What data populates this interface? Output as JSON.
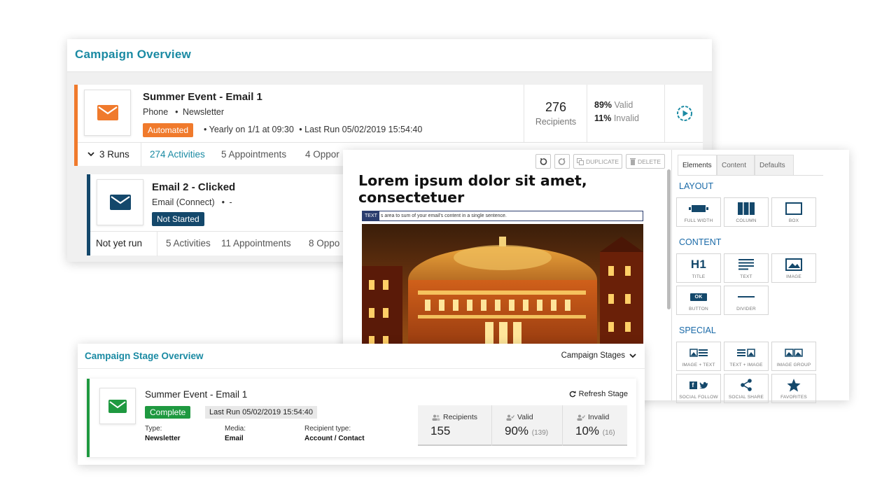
{
  "overview": {
    "title": "Campaign Overview",
    "card1": {
      "title": "Summer Event - Email 1",
      "media": "Phone",
      "type": "Newsletter",
      "badge": "Automated",
      "schedule": "Yearly on 1/1 at 09:30",
      "last_run": "Last Run 05/02/2019 15:54:40",
      "recipients_value": "276",
      "recipients_label": "Recipients",
      "valid_pct": "89%",
      "valid_label": "Valid",
      "invalid_pct": "11%",
      "invalid_label": "Invalid",
      "runs": "3 Runs",
      "activities": "274 Activities",
      "appointments": "5 Appointments",
      "opportunities": "4 Oppor"
    },
    "card2": {
      "title": "Email 2 - Clicked",
      "media": "Email (Connect)",
      "type": "-",
      "badge": "Not Started",
      "runs": "Not yet run",
      "activities": "5 Activities",
      "appointments": "11 Appointments",
      "opportunities": "8 Oppo"
    }
  },
  "editor": {
    "toolbar": {
      "duplicate": "DUPLICATE",
      "delete": "DELETE"
    },
    "headline": "Lorem ipsum dolor sit amet, consectetuer",
    "text_tag": "TEXT",
    "text_placeholder": "s area to sum of your email's content in a single sentence.",
    "tabs": [
      "Elements",
      "Content",
      "Defaults"
    ],
    "sections": {
      "layout": "LAYOUT",
      "content": "CONTENT",
      "special": "SPECIAL"
    },
    "layout_blocks": [
      "FULL WIDTH",
      "COLUMN",
      "BOX"
    ],
    "content_blocks": [
      "TITLE",
      "TEXT",
      "IMAGE",
      "BUTTON",
      "DIVIDER"
    ],
    "special_blocks": [
      "IMAGE + TEXT",
      "TEXT + IMAGE",
      "IMAGE GROUP",
      "SOCIAL FOLLOW",
      "SOCIAL SHARE",
      "FAVORITES"
    ],
    "h1_glyph": "H1",
    "ok_glyph": "OK",
    "social_glyph": "f"
  },
  "stage": {
    "title": "Campaign Stage Overview",
    "dropdown": "Campaign Stages",
    "card": {
      "title": "Summer Event - Email 1",
      "refresh": "Refresh Stage",
      "badge": "Complete",
      "last_run": "Last Run 05/02/2019 15:54:40",
      "type_label": "Type:",
      "type_value": "Newsletter",
      "media_label": "Media:",
      "media_value": "Email",
      "recipient_label": "Recipient type:",
      "recipient_value": "Account / Contact",
      "recipients_label": "Recipients",
      "recipients_value": "155",
      "valid_label": "Valid",
      "valid_value": "90%",
      "valid_count": "(139)",
      "invalid_label": "Invalid",
      "invalid_value": "10%",
      "invalid_count": "(16)"
    }
  },
  "colors": {
    "accent_teal": "#1a8aa3",
    "automated_orange": "#f07a2c",
    "not_started_navy": "#14486b",
    "complete_green": "#1f9940"
  }
}
